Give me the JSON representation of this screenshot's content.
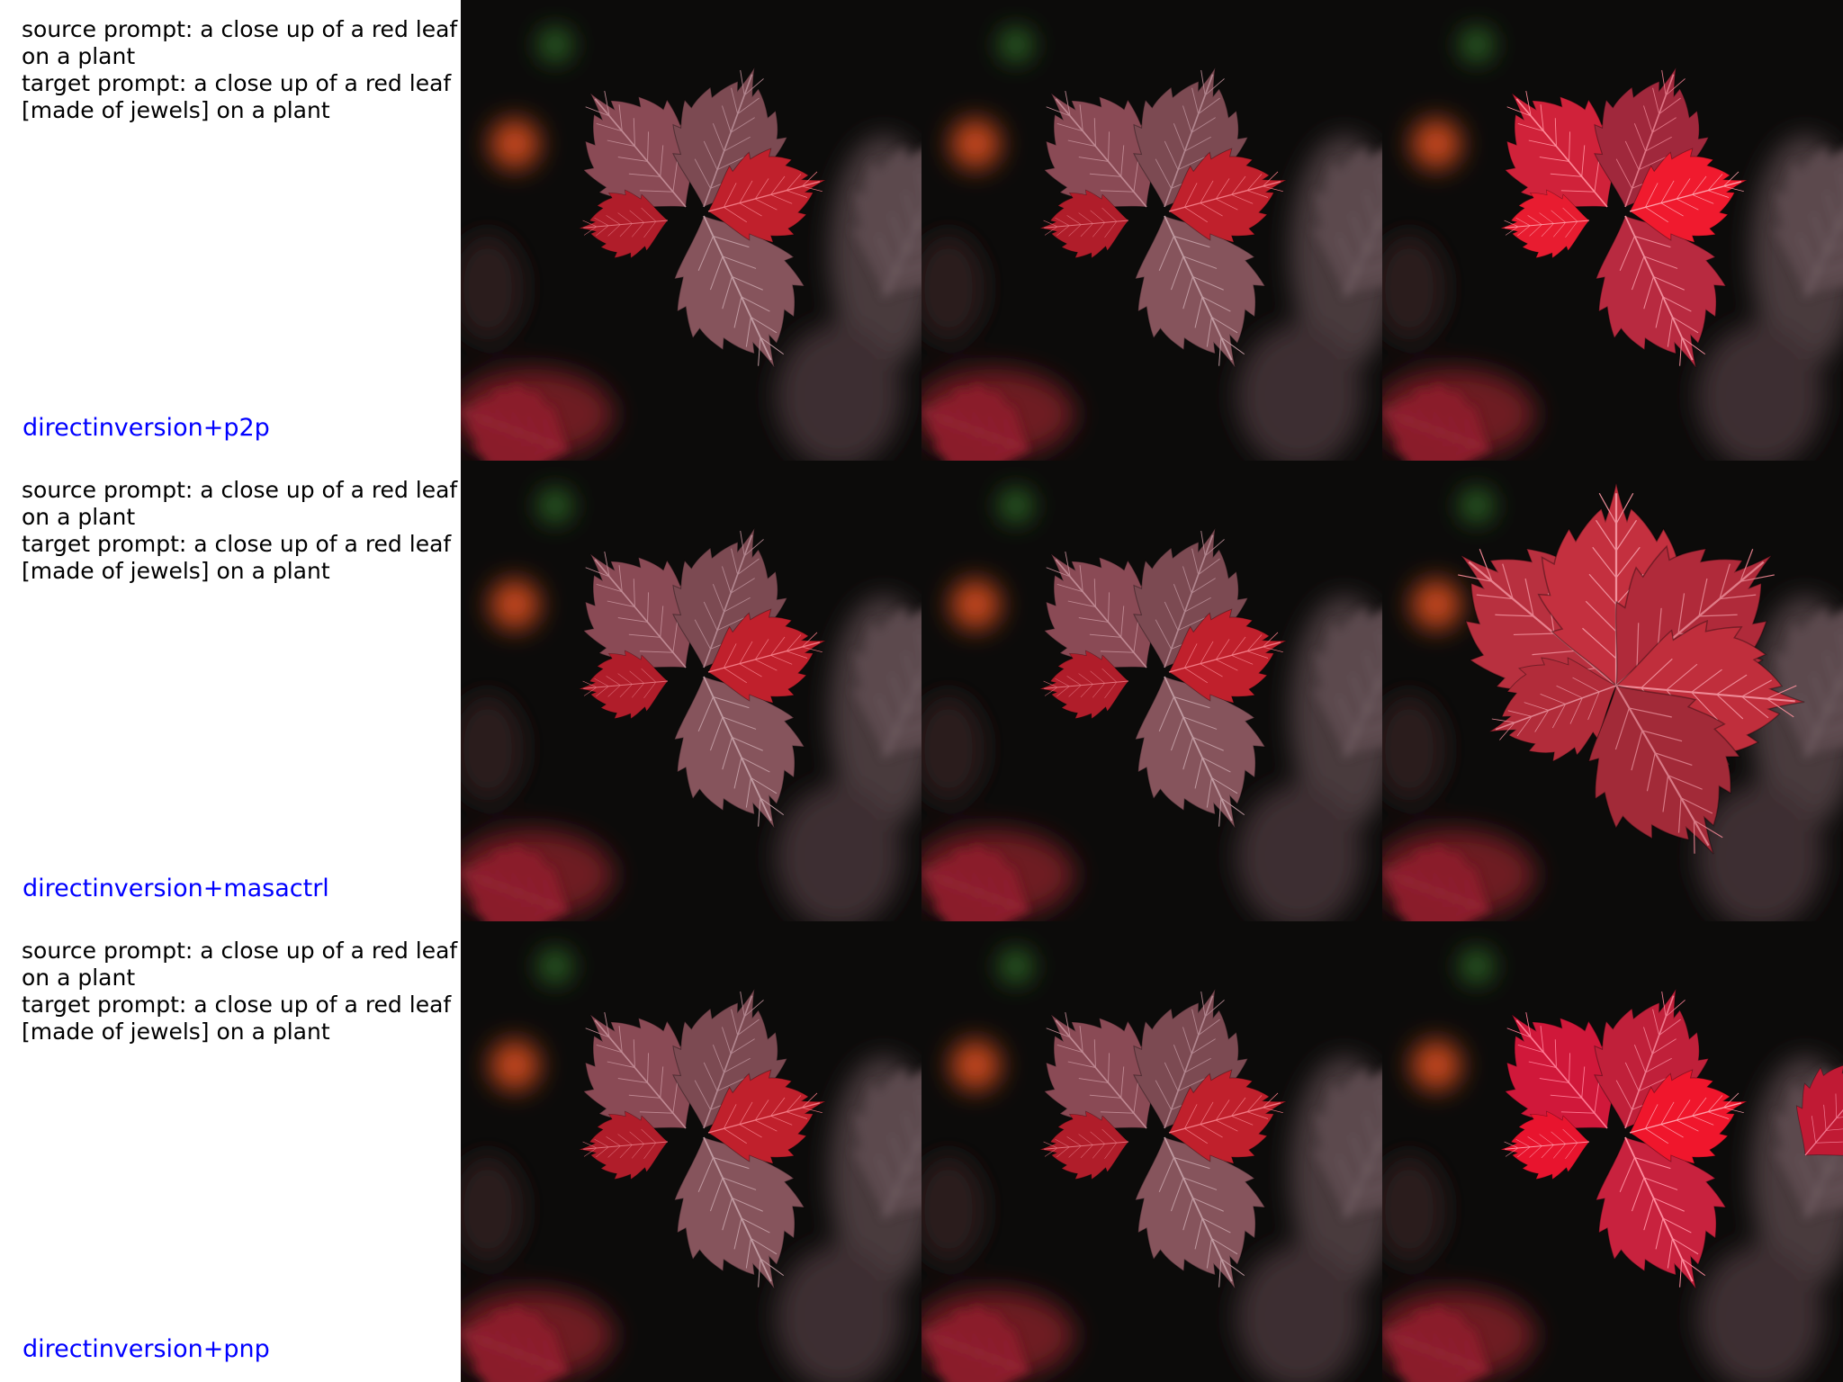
{
  "rows": [
    {
      "source_line1": "source prompt: a close up of a red leaf",
      "source_line2": "on a plant",
      "target_line1": "target prompt: a close up of a red leaf",
      "target_line2": "[made of jewels] on a plant",
      "method": "directinversion+p2p"
    },
    {
      "source_line1": "source prompt: a close up of a red leaf",
      "source_line2": "on a plant",
      "target_line1": "target prompt: a close up of a red leaf",
      "target_line2": "[made of jewels] on a plant",
      "method": "directinversion+masactrl"
    },
    {
      "source_line1": "source prompt: a close up of a red leaf",
      "source_line2": "on a plant",
      "target_line1": "target prompt: a close up of a red leaf",
      "target_line2": "[made of jewels] on a plant",
      "method": "directinversion+pnp"
    }
  ],
  "colors": {
    "method_label": "#0000ff",
    "prompt_text": "#000000",
    "background": "#ffffff"
  }
}
